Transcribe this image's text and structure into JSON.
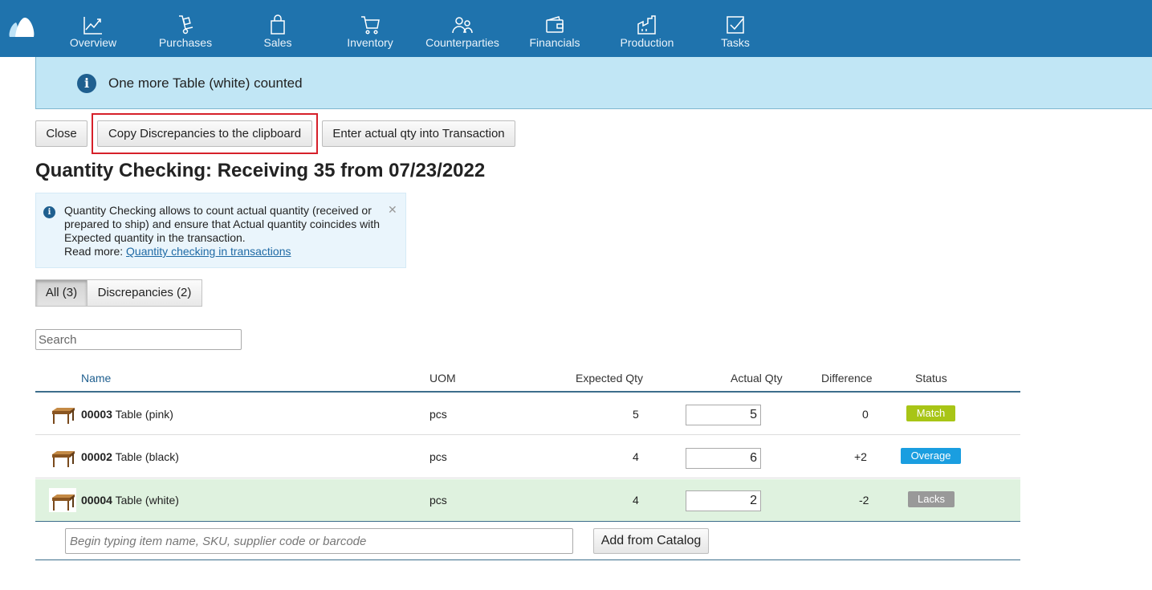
{
  "nav": {
    "items": [
      {
        "label": "Overview",
        "icon": "chart-line-icon"
      },
      {
        "label": "Purchases",
        "icon": "hand-truck-icon"
      },
      {
        "label": "Sales",
        "icon": "shopping-bag-icon"
      },
      {
        "label": "Inventory",
        "icon": "cart-icon"
      },
      {
        "label": "Counterparties",
        "icon": "people-icon"
      },
      {
        "label": "Financials",
        "icon": "wallet-icon"
      },
      {
        "label": "Production",
        "icon": "factory-icon"
      },
      {
        "label": "Tasks",
        "icon": "checkbox-icon"
      }
    ]
  },
  "notification": {
    "text": "One more Table (white) counted"
  },
  "toolbar": {
    "close_label": "Close",
    "copy_label": "Copy Discrepancies to the clipboard",
    "enter_label": "Enter actual qty into Transaction"
  },
  "page": {
    "title": "Quantity Checking: Receiving 35 from 07/23/2022"
  },
  "info": {
    "text": "Quantity Checking allows to count actual quantity (received or prepared to ship) and ensure that Actual quantity coincides with Expected quantity in the transaction.",
    "read_more": "Read more:",
    "link": "Quantity checking in transactions"
  },
  "filters": {
    "all": "All (3)",
    "discrepancies": "Discrepancies (2)"
  },
  "search": {
    "placeholder": "Search"
  },
  "table": {
    "headers": {
      "name": "Name",
      "uom": "UOM",
      "expected": "Expected Qty",
      "actual": "Actual Qty",
      "difference": "Difference",
      "status": "Status"
    },
    "rows": [
      {
        "sku": "00003",
        "name": "Table (pink)",
        "uom": "pcs",
        "expected": "5",
        "actual": "5",
        "difference": "0",
        "status": "Match",
        "status_color": "#a8c516"
      },
      {
        "sku": "00002",
        "name": "Table (black)",
        "uom": "pcs",
        "expected": "4",
        "actual": "6",
        "difference": "+2",
        "status": "Overage",
        "status_color": "#1a9ee0"
      },
      {
        "sku": "00004",
        "name": "Table (white)",
        "uom": "pcs",
        "expected": "4",
        "actual": "2",
        "difference": "-2",
        "status": "Lacks",
        "status_color": "#999999"
      }
    ]
  },
  "add_item": {
    "placeholder": "Begin typing item name, SKU, supplier code or barcode",
    "catalog_label": "Add from Catalog"
  },
  "colors": {
    "nav_bg": "#1f73ad",
    "notification_bg": "#c1e6f5",
    "highlight_row": "#dff2df",
    "highlight_box": "#d6202a"
  }
}
